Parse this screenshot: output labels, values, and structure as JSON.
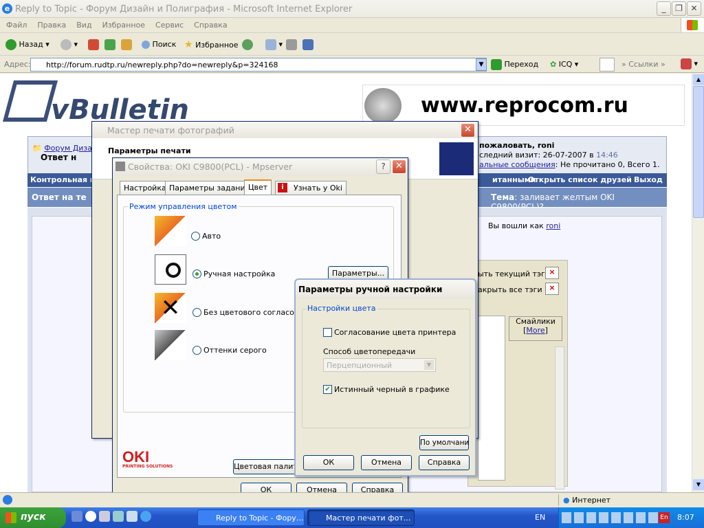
{
  "ie": {
    "title": "Reply to Topic - Форум Дизайн и Полиграфия - Microsoft Internet Explorer",
    "menu": [
      "Файл",
      "Правка",
      "Вид",
      "Избранное",
      "Сервис",
      "Справка"
    ],
    "toolbar": {
      "back": "Назад",
      "search": "Поиск",
      "favorites": "Избранное"
    },
    "address_label": "Адрес:",
    "address": "http://forum.rudtp.ru/newreply.php?do=newreply&p=324168",
    "go": "Переход",
    "icq": "ICQ",
    "links": "Ссылки",
    "status_zone": "Интернет"
  },
  "forum": {
    "logo": "vBulletin",
    "banner": "www.reprocom.ru",
    "breadcrumb_1": "Форум Дизайн",
    "breadcrumb_2": "Ответ н",
    "welcome": "пожаловать, roni",
    "last_visit": "следний визит: 26-07-2007 в",
    "last_visit_time": "14:46",
    "pm_link": "альные сообщения",
    "pm_text": ": Не прочитано 0, Всего 1.",
    "nav_left": "Контрольная п",
    "nav_right": [
      "итанными",
      "Открыть список друзей",
      "Выход"
    ],
    "reply_title": "Ответ на те",
    "topic_label": "Тема",
    "topic": ": заливает желтым OKI C9800(PCL)?",
    "logged_in": "Вы вошли как",
    "logged_user": "roni",
    "close_tag": "ыть текущий тэг",
    "close_all": "акрыть все тэги",
    "smilies": "Смайлики",
    "more": "More"
  },
  "wizard": {
    "title": "Мастер печати фотографий",
    "heading": "Параметры печати"
  },
  "props": {
    "title": "Свойства: OKI C9800(PCL) - Mpserver",
    "tabs": [
      "Настройка",
      "Параметры задания",
      "Цвет",
      "Узнать у Oki"
    ],
    "group": "Режим управления цветом",
    "options": [
      "Авто",
      "Ручная настройка",
      "Без цветового согласования",
      "Оттенки серого"
    ],
    "params_btn": "Параметры...",
    "color_palette_btn": "Цветовая палитра",
    "ok": "ОК",
    "cancel": "Отмена",
    "help": "Справка",
    "oki_logo": "OKI",
    "oki_sub": "PRINTING SOLUTIONS"
  },
  "manual": {
    "title": "Параметры ручной настройки",
    "group": "Настройки цвета",
    "match": "Согласование цвета принтера",
    "method_label": "Способ цветопередачи",
    "method_value": "Перцепционный",
    "true_black": "Истинный черный в графике",
    "default_btn": "По умолчанию",
    "ok": "ОК",
    "cancel": "Отмена",
    "help": "Справка"
  },
  "taskbar": {
    "start": "пуск",
    "tasks": [
      "Reply to Topic - Фору...",
      "Мастер печати фот..."
    ],
    "lang": "EN",
    "clock": "8:07"
  }
}
